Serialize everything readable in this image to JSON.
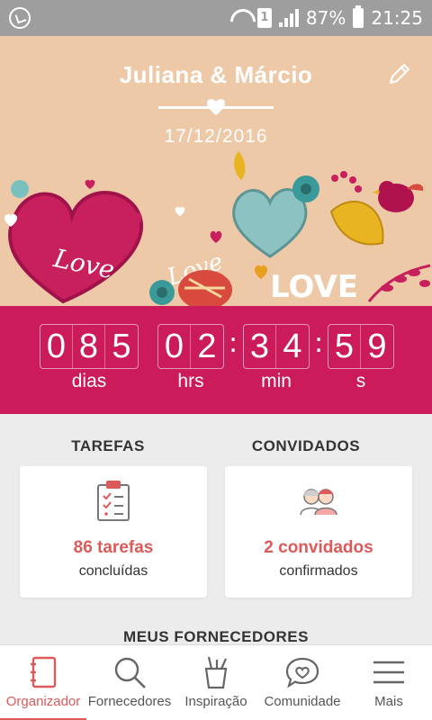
{
  "status_bar": {
    "battery_percent": "87%",
    "time": "21:25",
    "sim_label": "1",
    "icons": [
      "whatsapp-icon",
      "wifi-icon",
      "sim-icon",
      "signal-icon",
      "battery-icon"
    ]
  },
  "header": {
    "couple_names": "Juliana & Márcio",
    "wedding_date": "17/12/2016",
    "illustration_texts": [
      "Love",
      "Love",
      "LOVE"
    ],
    "icons": [
      "edit-pencil-icon",
      "heart-divider-icon"
    ]
  },
  "countdown": {
    "days": [
      "0",
      "8",
      "5"
    ],
    "hours": [
      "0",
      "2"
    ],
    "minutes": [
      "3",
      "4"
    ],
    "seconds": [
      "5",
      "9"
    ],
    "labels": {
      "days": "dias",
      "hours": "hrs",
      "minutes": "min",
      "seconds": "s"
    },
    "background_color": "#cc1b5a"
  },
  "tasks": {
    "title": "TAREFAS",
    "count": "86 tarefas",
    "status": "concluídas",
    "icon": "clipboard-checklist-icon"
  },
  "guests": {
    "title": "CONVIDADOS",
    "count": "2 convidados",
    "status": "confirmados",
    "icon": "couple-guests-icon"
  },
  "suppliers_title": "MEUS FORNECEDORES",
  "bottom_nav": {
    "items": [
      {
        "label": "Organizador",
        "icon": "notebook-icon",
        "active": true
      },
      {
        "label": "Fornecedores",
        "icon": "search-icon",
        "active": false
      },
      {
        "label": "Inspiração",
        "icon": "pencil-cup-icon",
        "active": false
      },
      {
        "label": "Comunidade",
        "icon": "chat-heart-icon",
        "active": false
      },
      {
        "label": "Mais",
        "icon": "menu-icon",
        "active": false
      }
    ],
    "accent_color": "#dd5a5a"
  }
}
